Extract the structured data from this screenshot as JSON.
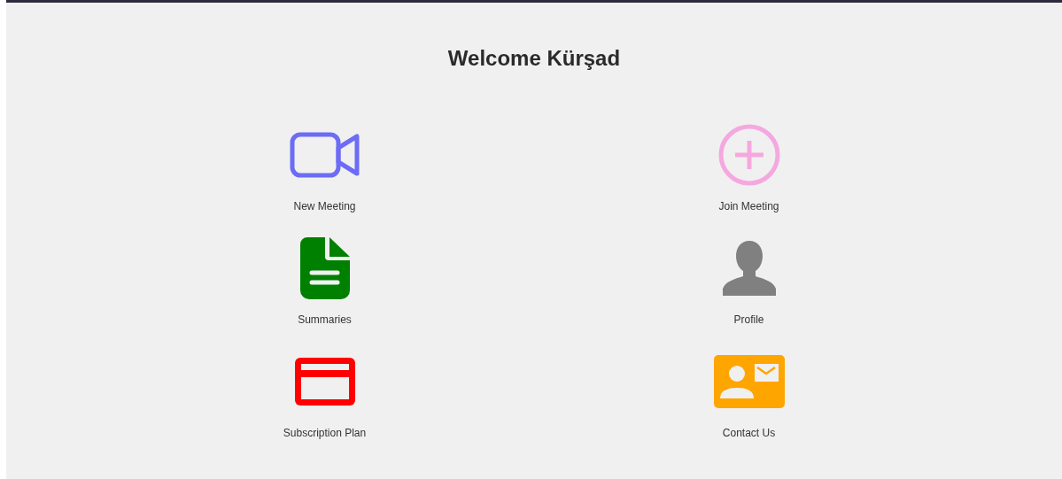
{
  "title": "Welcome Kürşad",
  "menu": [
    {
      "kind": "video",
      "label": "New Meeting",
      "color": "#6c6cf5"
    },
    {
      "kind": "plus",
      "label": "Join Meeting",
      "color": "#f5a8e0"
    },
    {
      "kind": "document",
      "label": "Summaries",
      "color": "#008000"
    },
    {
      "kind": "person",
      "label": "Profile",
      "color": "#808080"
    },
    {
      "kind": "card",
      "label": "Subscription Plan",
      "color": "#ff0000"
    },
    {
      "kind": "contact",
      "label": "Contact Us",
      "color": "#ffa500"
    }
  ]
}
